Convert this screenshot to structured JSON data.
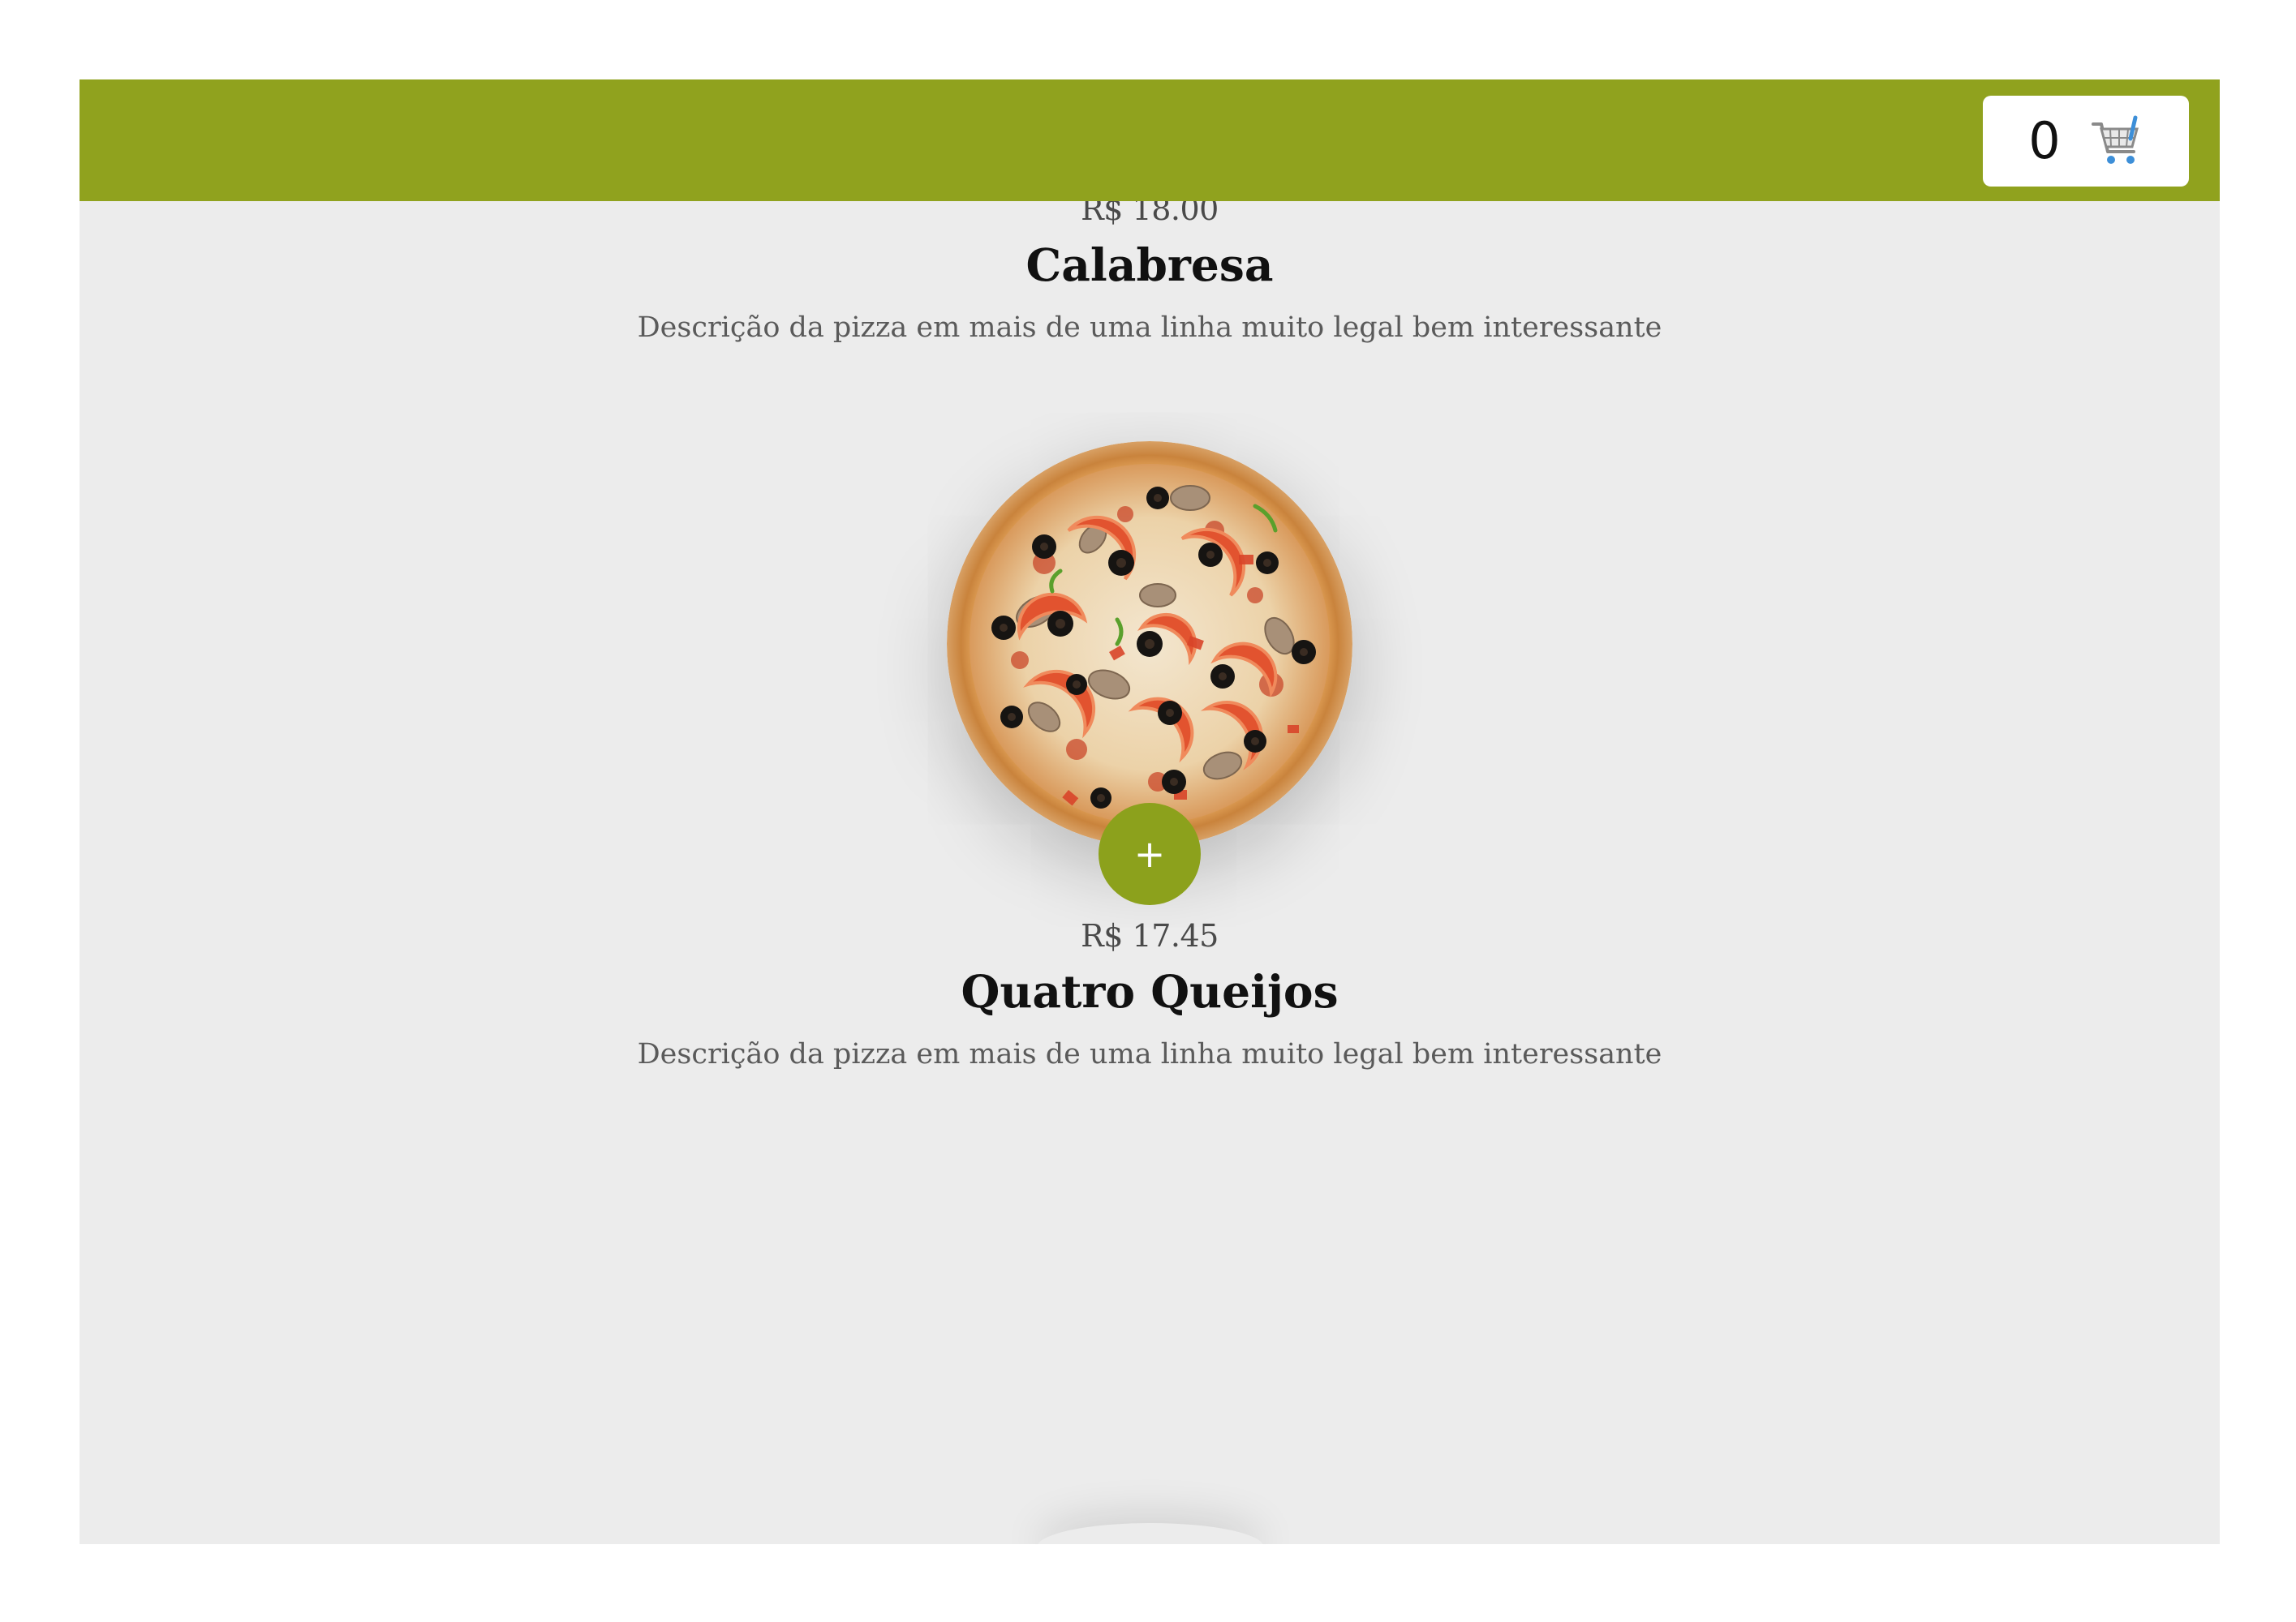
{
  "header": {
    "background_color": "#90a21e",
    "cart": {
      "count": "0",
      "icon": "shopping-cart-icon"
    }
  },
  "products": [
    {
      "price": "R$ 18.00",
      "name": "Calabresa",
      "description": "Descrição da pizza em mais de uma linha muito legal bem interessante"
    },
    {
      "image_icon": "pizza-image",
      "add_label": "+",
      "price": "R$ 17.45",
      "name": "Quatro Queijos",
      "description": "Descrição da pizza em mais de uma linha muito legal bem interessante"
    }
  ],
  "colors": {
    "accent": "#8ca11c",
    "page_background": "#ececec"
  }
}
